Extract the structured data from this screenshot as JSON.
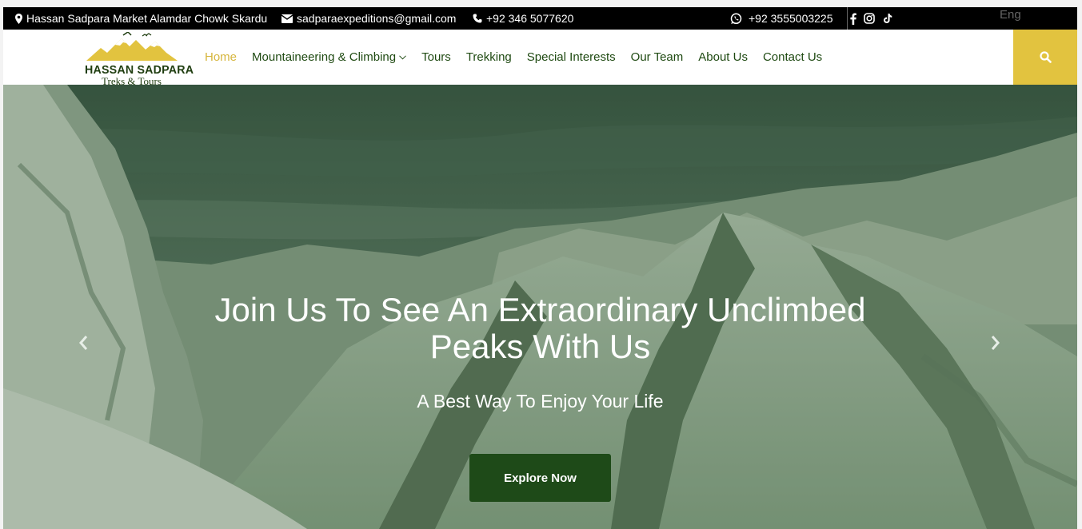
{
  "topbar": {
    "address": "Hassan Sadpara Market Alamdar Chowk Skardu",
    "email": "sadparaexpeditions@gmail.com",
    "phone": "+92 346 5077620",
    "whatsapp": "+92 3555003225",
    "social_icons": [
      "facebook-icon",
      "instagram-icon",
      "tiktok-icon"
    ],
    "language": "Eng"
  },
  "logo": {
    "title": "HASSAN SADPARA",
    "subtitle": "Treks & Tours"
  },
  "nav": {
    "items": [
      {
        "label": "Home",
        "active": true
      },
      {
        "label": "Mountaineering & Climbing",
        "has_dropdown": true
      },
      {
        "label": "Tours"
      },
      {
        "label": "Trekking"
      },
      {
        "label": "Special Interests"
      },
      {
        "label": "Our Team"
      },
      {
        "label": "About Us"
      },
      {
        "label": "Contact Us"
      }
    ]
  },
  "hero": {
    "headline_line1": "Join Us To See An Extraordinary Unclimbed",
    "headline_line2": "Peaks With Us",
    "subline": "A Best Way To Enjoy Your Life",
    "cta_label": "Explore Now"
  },
  "colors": {
    "accent": "#e2c33f",
    "brand_green": "#1e4a18",
    "nav_text": "#1f4a12",
    "topbar_bg": "#000000"
  }
}
